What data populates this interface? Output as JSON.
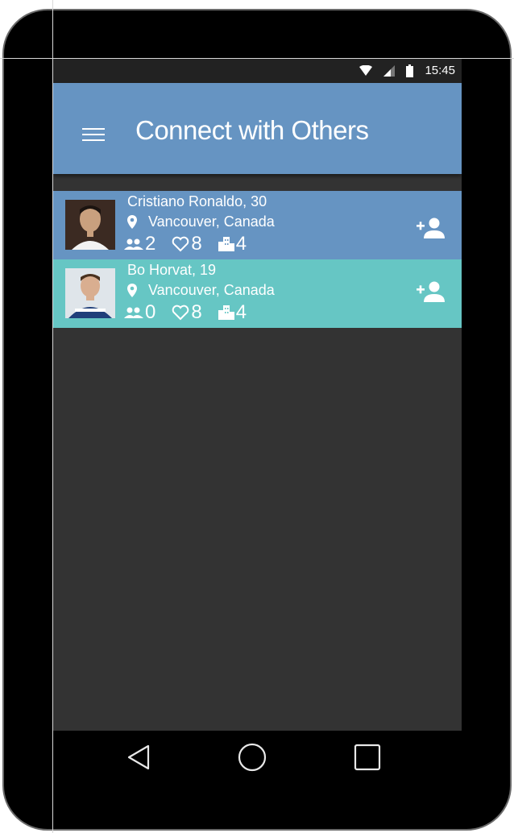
{
  "status_bar": {
    "time": "15:45",
    "icons": [
      "wifi-icon",
      "signal-icon",
      "battery-icon"
    ]
  },
  "app_bar": {
    "title": "Connect with Others",
    "menu_icon": "hamburger-menu-icon"
  },
  "people": [
    {
      "name_age": "Cristiano Ronaldo, 30",
      "location": "Vancouver, Canada",
      "friends": "2",
      "likes": "8",
      "places": "4",
      "accent": "#6694c2"
    },
    {
      "name_age": "Bo Horvat, 19",
      "location": "Vancouver, Canada",
      "friends": "0",
      "likes": "8",
      "places": "4",
      "accent": "#66c6c4"
    }
  ],
  "nav_bar": {
    "buttons": [
      "back-icon",
      "home-icon",
      "recents-icon"
    ]
  },
  "colors": {
    "app_bar": "#6694c2",
    "screen_background": "#333333",
    "card_primary": "#6694c2",
    "card_secondary": "#66c6c4"
  }
}
